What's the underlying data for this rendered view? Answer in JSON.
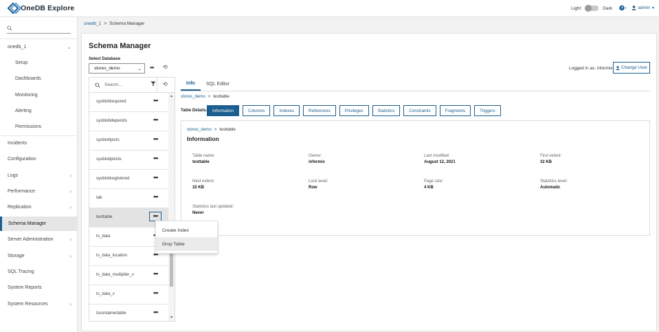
{
  "app": {
    "name": "OneDB Explore",
    "theme_light": "Light",
    "theme_dark": "Dark",
    "help_icon": "help-circle-icon",
    "user_label": "admin",
    "accent_color": "#1b5e8f"
  },
  "sidebar": {
    "search_placeholder": "",
    "server": "onedb_1",
    "items": [
      {
        "label": "Setup"
      },
      {
        "label": "Dashboards"
      },
      {
        "label": "Monitoring"
      },
      {
        "label": "Alerting"
      },
      {
        "label": "Permissions"
      },
      {
        "label": "Incidents"
      },
      {
        "label": "Configuration"
      },
      {
        "label": "Logs"
      },
      {
        "label": "Performance"
      },
      {
        "label": "Replication"
      },
      {
        "label": "Schema Manager"
      },
      {
        "label": "Server Administration"
      },
      {
        "label": "Storage"
      },
      {
        "label": "SQL Tracing"
      },
      {
        "label": "System Reports"
      },
      {
        "label": "System Resources"
      }
    ]
  },
  "breadcrumb": {
    "server": "onedb_1",
    "current": "Schema Manager"
  },
  "main": {
    "title": "Schema Manager",
    "select_db_label": "Select Database",
    "selected_db": "stores_demo",
    "logged_in_as": "Logged in as: informix",
    "change_user": "Change User"
  },
  "table_list": {
    "search_placeholder": "Search...",
    "rows": [
      "sysblobrequired",
      "sysblobdepends",
      "sysblobjects",
      "sysblobjkinds",
      "sysblobregistered",
      "tab",
      "testtable",
      "ts_data",
      "ts_data_location",
      "ts_data_multiplier_v",
      "ts_data_v",
      "tscontainertable"
    ],
    "selected": "testtable"
  },
  "context_menu": {
    "items": [
      "Create Index",
      "Drop Table"
    ]
  },
  "tabs": [
    "Info",
    "SQL Editor"
  ],
  "right_breadcrumb": {
    "db": "stores_demo",
    "table": "testtable"
  },
  "table_details": {
    "label": "Table Details:",
    "buttons": [
      "Information",
      "Columns",
      "Indexes",
      "References",
      "Privileges",
      "Statistics",
      "Constraints",
      "Fragments",
      "Triggers"
    ]
  },
  "info": {
    "crumb_db": "stores_demo",
    "crumb_table": "testtable",
    "title": "Information",
    "fields": [
      {
        "k": "Table name:",
        "v": "testtable"
      },
      {
        "k": "Owner:",
        "v": "informix"
      },
      {
        "k": "Last modified:",
        "v": "August 12, 2021"
      },
      {
        "k": "First extent:",
        "v": "32 KB"
      },
      {
        "k": "Next extent:",
        "v": "32 KB"
      },
      {
        "k": "Lock level:",
        "v": "Row"
      },
      {
        "k": "Page size:",
        "v": "4 KB"
      },
      {
        "k": "Statistics level:",
        "v": "Automatic"
      },
      {
        "k": "Statistics last updated:",
        "v": "Never"
      }
    ]
  }
}
